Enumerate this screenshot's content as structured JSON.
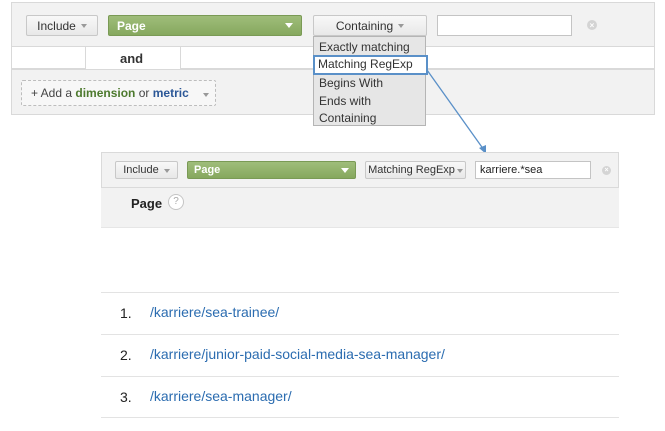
{
  "top_filter": {
    "include_label": "Include",
    "dimension_label": "Page",
    "match_label": "Containing",
    "value": "",
    "and_label": "and",
    "add_prefix": "+ Add a ",
    "add_dimension": "dimension",
    "add_or": " or ",
    "add_metric": "metric"
  },
  "dropdown": {
    "options": [
      "Exactly matching",
      "Matching RegExp",
      "Begins With",
      "Ends with",
      "Containing"
    ],
    "selected_index": 1
  },
  "bottom_filter": {
    "include_label": "Include",
    "dimension_label": "Page",
    "match_label": "Matching RegExp",
    "value": "karriere.*sea"
  },
  "table": {
    "column_header": "Page",
    "help_icon": "?",
    "rows": [
      {
        "num": "1.",
        "path": "/karriere/sea-trainee/"
      },
      {
        "num": "2.",
        "path": "/karriere/junior-paid-social-media-sea-manager/"
      },
      {
        "num": "3.",
        "path": "/karriere/sea-manager/"
      }
    ]
  },
  "colors": {
    "accent_green": "#8aab62",
    "link_blue": "#2b6cb0",
    "highlight_border": "#5a90c8",
    "arrow": "#5a90c8"
  }
}
